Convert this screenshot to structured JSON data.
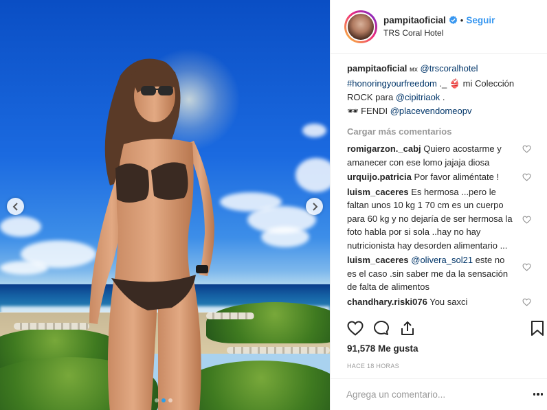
{
  "header": {
    "username": "pampitaoficial",
    "separator": "•",
    "follow_label": "Seguir",
    "location": "TRS Coral Hotel"
  },
  "caption": {
    "username": "pampitaoficial",
    "flag": "ᴍx",
    "mention1": "@trscoralhotel",
    "hashtag": "#honoringyourfreedom",
    "text1": " ._ 👙 mi Colección ROCK para ",
    "mention2": "@cipitriaok",
    "text2": " .",
    "sunglasses": "🕶 FENDI ",
    "mention3": "@placevendomeopv"
  },
  "load_more_label": "Cargar más comentarios",
  "comments": [
    {
      "user": "romigarzon._cabj",
      "text": "Quiero acostarme y amanecer con ese lomo jajaja diosa"
    },
    {
      "user": "urquijo.patricia",
      "text": "Por favor aliméntate !"
    },
    {
      "user": "luism_caceres",
      "text": "Es hermosa ...pero le faltan unos 10 kg 1 70 cm es un cuerpo para 60 kg y no dejaría de ser hermosa la foto habla por si sola ..hay no hay nutricionista hay desorden alimentario ..."
    },
    {
      "user": "luism_caceres",
      "mention": "@olivera_sol21",
      "text": " este no es el caso .sin saber me da la sensación de falta de alimentos"
    },
    {
      "user": "chandhary.riski076",
      "text": "You saxci"
    }
  ],
  "likes": "91,578 Me gusta",
  "timestamp": "HACE 18 HORAS",
  "comment_input": {
    "placeholder": "Agrega un comentario..."
  },
  "carousel": {
    "slides": 3,
    "active": 2
  },
  "colors": {
    "accent": "#3897f0",
    "link": "#003569",
    "muted": "#999999"
  },
  "icons": [
    "verified-badge-icon",
    "heart-icon",
    "comment-icon",
    "share-icon",
    "bookmark-icon",
    "more-options-icon",
    "chevron-left-icon",
    "chevron-right-icon"
  ]
}
